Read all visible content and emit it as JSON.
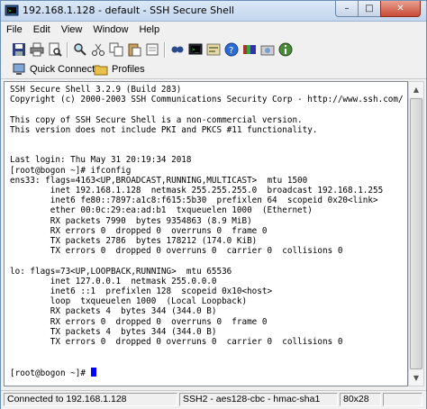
{
  "window": {
    "title": "192.168.1.128 - default - SSH Secure Shell",
    "minimize_glyph": "–",
    "maximize_glyph": "□",
    "close_glyph": "✕"
  },
  "menu": {
    "items": [
      "File",
      "Edit",
      "View",
      "Window",
      "Help"
    ]
  },
  "toolbar": {
    "icons": [
      "save-icon",
      "print-icon",
      "print-preview-icon",
      "find-icon",
      "cut-icon",
      "copy-icon",
      "paste-icon",
      "paste-special-icon",
      "find-file-icon",
      "new-terminal-icon",
      "settings-icon",
      "help-icon",
      "keys-icon",
      "profile-icon",
      "info-icon"
    ]
  },
  "quickbar": {
    "quick_connect_label": "Quick Connect",
    "profiles_label": "Profiles"
  },
  "terminal": {
    "lines": [
      "SSH Secure Shell 3.2.9 (Build 283)",
      "Copyright (c) 2000-2003 SSH Communications Security Corp - http://www.ssh.com/",
      "",
      "This copy of SSH Secure Shell is a non-commercial version.",
      "This version does not include PKI and PKCS #11 functionality.",
      "",
      "",
      "Last login: Thu May 31 20:19:34 2018",
      "[root@bogon ~]# ifconfig",
      "ens33: flags=4163<UP,BROADCAST,RUNNING,MULTICAST>  mtu 1500",
      "        inet 192.168.1.128  netmask 255.255.255.0  broadcast 192.168.1.255",
      "        inet6 fe80::7897:a1c8:f615:5b30  prefixlen 64  scopeid 0x20<link>",
      "        ether 00:0c:29:ea:ad:b1  txqueuelen 1000  (Ethernet)",
      "        RX packets 7990  bytes 9354863 (8.9 MiB)",
      "        RX errors 0  dropped 0  overruns 0  frame 0",
      "        TX packets 2786  bytes 178212 (174.0 KiB)",
      "        TX errors 0  dropped 0 overruns 0  carrier 0  collisions 0",
      "",
      "lo: flags=73<UP,LOOPBACK,RUNNING>  mtu 65536",
      "        inet 127.0.0.1  netmask 255.0.0.0",
      "        inet6 ::1  prefixlen 128  scopeid 0x10<host>",
      "        loop  txqueuelen 1000  (Local Loopback)",
      "        RX packets 4  bytes 344 (344.0 B)",
      "        RX errors 0  dropped 0  overruns 0  frame 0",
      "        TX packets 4  bytes 344 (344.0 B)",
      "        TX errors 0  dropped 0 overruns 0  carrier 0  collisions 0",
      "",
      ""
    ],
    "prompt": "[root@bogon ~]# ",
    "cursor_color": "#0000ff"
  },
  "scrollbar": {
    "up_glyph": "▲",
    "down_glyph": "▼"
  },
  "status": {
    "connection": "Connected to 192.168.1.128",
    "encryption": "SSH2 - aes128-cbc - hmac-sha1",
    "size": "80x28"
  }
}
